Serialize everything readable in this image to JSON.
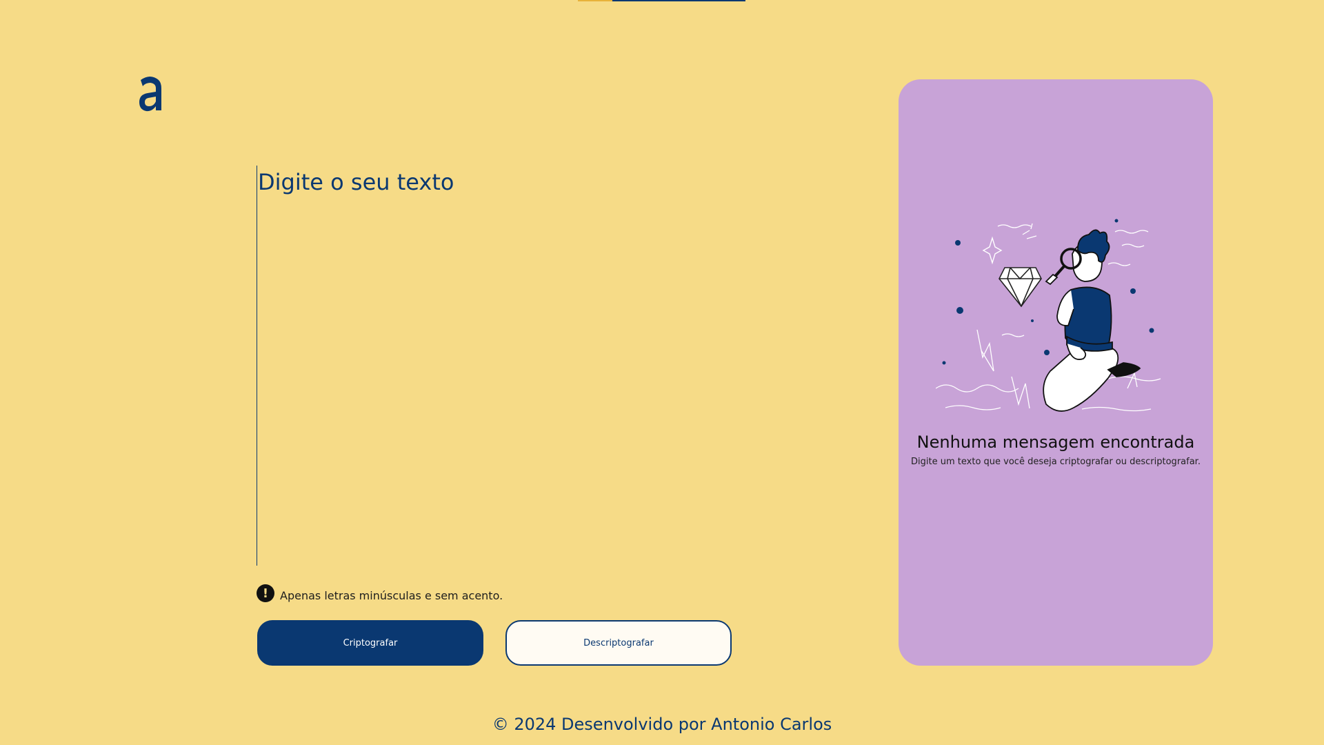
{
  "colors": {
    "background": "#F6DB87",
    "primary": "#0A3871",
    "panel": "#C8A3D7",
    "secondary_button_bg": "#FFFBF3"
  },
  "logo": {
    "icon": "alura-a-logo"
  },
  "input": {
    "placeholder": "Digite o seu texto",
    "value": ""
  },
  "hint": {
    "icon": "exclamation-circle-icon",
    "text": "Apenas letras minúsculas e sem acento."
  },
  "buttons": {
    "encrypt_label": "Criptografar",
    "decrypt_label": "Descriptografar"
  },
  "output_panel": {
    "illustration": "person-with-magnifying-glass-and-diamond",
    "title": "Nenhuma mensagem encontrada",
    "subtitle": "Digite um texto que você deseja criptografar ou descriptografar."
  },
  "footer": {
    "text": "© 2024 Desenvolvido por Antonio Carlos"
  }
}
